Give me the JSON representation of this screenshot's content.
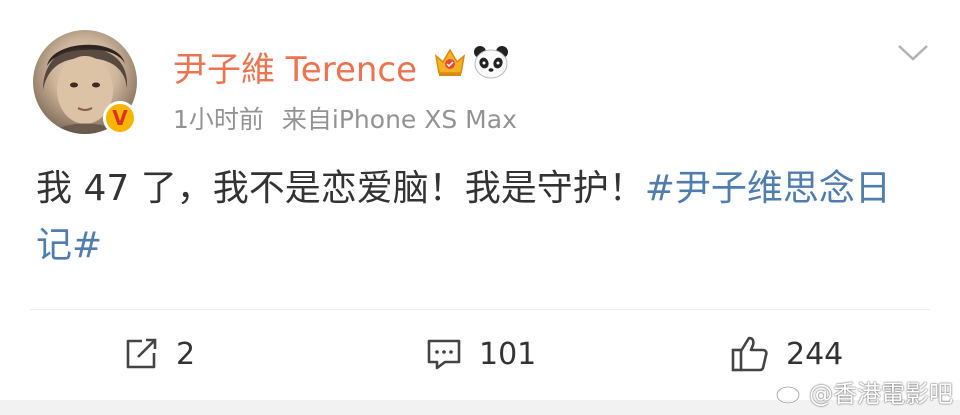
{
  "post": {
    "username": "尹子維 Terence",
    "time": "1小时前",
    "source": "来自iPhone XS Max",
    "content_text": "我 47 了，我不是恋爱脑！我是守护！",
    "hashtag": "#尹子维思念日记#",
    "verified_badge": "V"
  },
  "icons": {
    "crown": "crown-icon",
    "panda": "panda-icon",
    "chevron": "chevron-down-icon",
    "repost": "repost-icon",
    "comment": "comment-icon",
    "like": "like-icon",
    "weibo": "weibo-icon"
  },
  "actions": {
    "repost_count": "2",
    "comment_count": "101",
    "like_count": "244"
  },
  "watermark": {
    "text": "@香港電影吧"
  },
  "colors": {
    "username": "#eb7350",
    "hashtag": "#507daf",
    "meta": "#939393",
    "text": "#333333"
  }
}
